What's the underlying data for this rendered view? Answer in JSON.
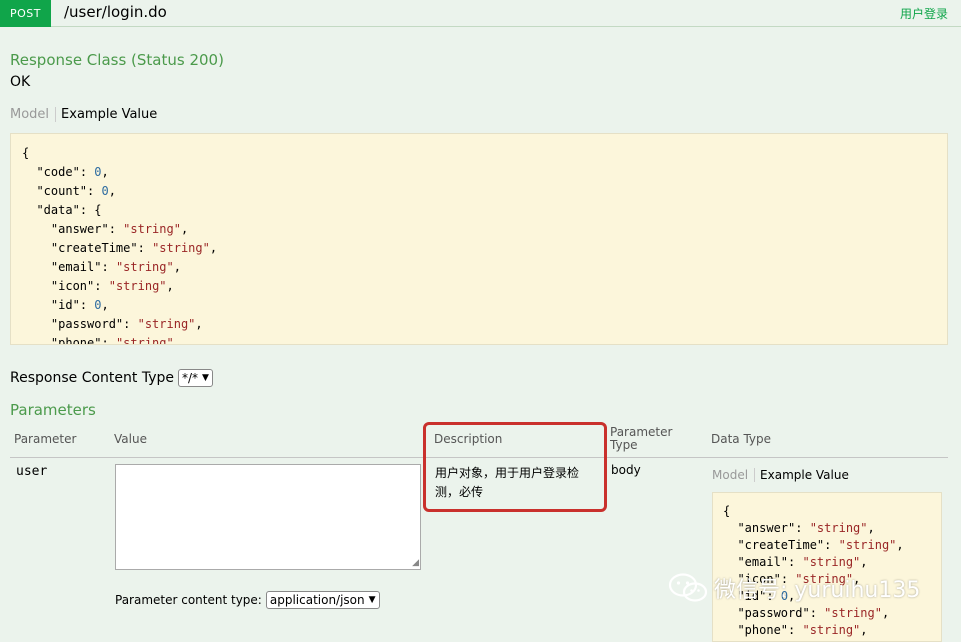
{
  "operation": {
    "method": "POST",
    "path": "/user/login.do",
    "summary": "用户登录"
  },
  "response_class": {
    "title": "Response Class (Status 200)",
    "status_text": "OK",
    "tabs": {
      "model": "Model",
      "example": "Example Value"
    },
    "example_lines": [
      [
        {
          "t": "p",
          "v": "{"
        }
      ],
      [
        {
          "t": "p",
          "v": "  "
        },
        {
          "t": "k",
          "v": "\"code\""
        },
        {
          "t": "p",
          "v": ": "
        },
        {
          "t": "n",
          "v": "0"
        },
        {
          "t": "p",
          "v": ","
        }
      ],
      [
        {
          "t": "p",
          "v": "  "
        },
        {
          "t": "k",
          "v": "\"count\""
        },
        {
          "t": "p",
          "v": ": "
        },
        {
          "t": "n",
          "v": "0"
        },
        {
          "t": "p",
          "v": ","
        }
      ],
      [
        {
          "t": "p",
          "v": "  "
        },
        {
          "t": "k",
          "v": "\"data\""
        },
        {
          "t": "p",
          "v": ": {"
        }
      ],
      [
        {
          "t": "p",
          "v": "    "
        },
        {
          "t": "k",
          "v": "\"answer\""
        },
        {
          "t": "p",
          "v": ": "
        },
        {
          "t": "s",
          "v": "\"string\""
        },
        {
          "t": "p",
          "v": ","
        }
      ],
      [
        {
          "t": "p",
          "v": "    "
        },
        {
          "t": "k",
          "v": "\"createTime\""
        },
        {
          "t": "p",
          "v": ": "
        },
        {
          "t": "s",
          "v": "\"string\""
        },
        {
          "t": "p",
          "v": ","
        }
      ],
      [
        {
          "t": "p",
          "v": "    "
        },
        {
          "t": "k",
          "v": "\"email\""
        },
        {
          "t": "p",
          "v": ": "
        },
        {
          "t": "s",
          "v": "\"string\""
        },
        {
          "t": "p",
          "v": ","
        }
      ],
      [
        {
          "t": "p",
          "v": "    "
        },
        {
          "t": "k",
          "v": "\"icon\""
        },
        {
          "t": "p",
          "v": ": "
        },
        {
          "t": "s",
          "v": "\"string\""
        },
        {
          "t": "p",
          "v": ","
        }
      ],
      [
        {
          "t": "p",
          "v": "    "
        },
        {
          "t": "k",
          "v": "\"id\""
        },
        {
          "t": "p",
          "v": ": "
        },
        {
          "t": "n",
          "v": "0"
        },
        {
          "t": "p",
          "v": ","
        }
      ],
      [
        {
          "t": "p",
          "v": "    "
        },
        {
          "t": "k",
          "v": "\"password\""
        },
        {
          "t": "p",
          "v": ": "
        },
        {
          "t": "s",
          "v": "\"string\""
        },
        {
          "t": "p",
          "v": ","
        }
      ],
      [
        {
          "t": "p",
          "v": "    "
        },
        {
          "t": "k",
          "v": "\"phone\""
        },
        {
          "t": "p",
          "v": ": "
        },
        {
          "t": "s",
          "v": "\"string\""
        },
        {
          "t": "p",
          "v": ","
        }
      ]
    ]
  },
  "response_content_type": {
    "label": "Response Content Type",
    "selected": "*/*"
  },
  "parameters": {
    "title": "Parameters",
    "headers": {
      "parameter": "Parameter",
      "value": "Value",
      "description": "Description",
      "parameter_type": "Parameter\nType",
      "data_type": "Data Type"
    },
    "rows": [
      {
        "name": "user",
        "value": "",
        "description": "用户对象，用于用户登录检测，必传",
        "parameter_type": "body",
        "data_type_tabs": {
          "model": "Model",
          "example": "Example Value"
        },
        "example_lines": [
          [
            {
              "t": "p",
              "v": "{"
            }
          ],
          [
            {
              "t": "p",
              "v": "  "
            },
            {
              "t": "k",
              "v": "\"answer\""
            },
            {
              "t": "p",
              "v": ": "
            },
            {
              "t": "s",
              "v": "\"string\""
            },
            {
              "t": "p",
              "v": ","
            }
          ],
          [
            {
              "t": "p",
              "v": "  "
            },
            {
              "t": "k",
              "v": "\"createTime\""
            },
            {
              "t": "p",
              "v": ": "
            },
            {
              "t": "s",
              "v": "\"string\""
            },
            {
              "t": "p",
              "v": ","
            }
          ],
          [
            {
              "t": "p",
              "v": "  "
            },
            {
              "t": "k",
              "v": "\"email\""
            },
            {
              "t": "p",
              "v": ": "
            },
            {
              "t": "s",
              "v": "\"string\""
            },
            {
              "t": "p",
              "v": ","
            }
          ],
          [
            {
              "t": "p",
              "v": "  "
            },
            {
              "t": "k",
              "v": "\"icon\""
            },
            {
              "t": "p",
              "v": ": "
            },
            {
              "t": "s",
              "v": "\"string\""
            },
            {
              "t": "p",
              "v": ","
            }
          ],
          [
            {
              "t": "p",
              "v": "  "
            },
            {
              "t": "k",
              "v": "\"id\""
            },
            {
              "t": "p",
              "v": ": "
            },
            {
              "t": "n",
              "v": "0"
            },
            {
              "t": "p",
              "v": ","
            }
          ],
          [
            {
              "t": "p",
              "v": "  "
            },
            {
              "t": "k",
              "v": "\"password\""
            },
            {
              "t": "p",
              "v": ": "
            },
            {
              "t": "s",
              "v": "\"string\""
            },
            {
              "t": "p",
              "v": ","
            }
          ],
          [
            {
              "t": "p",
              "v": "  "
            },
            {
              "t": "k",
              "v": "\"phone\""
            },
            {
              "t": "p",
              "v": ": "
            },
            {
              "t": "s",
              "v": "\"string\""
            },
            {
              "t": "p",
              "v": ","
            }
          ]
        ]
      }
    ],
    "content_type": {
      "label": "Parameter content type:",
      "selected": "application/json"
    }
  },
  "watermark": {
    "text": "微信号: yuruihu135",
    "icon": "wechat-icon"
  },
  "colors": {
    "post_badge": "#10a54a",
    "heading_green": "#4b9a4b",
    "code_bg": "#fcf6db",
    "highlight_red": "#c9302c",
    "string_value": "#9a2626",
    "number_value": "#2c6ba0"
  }
}
